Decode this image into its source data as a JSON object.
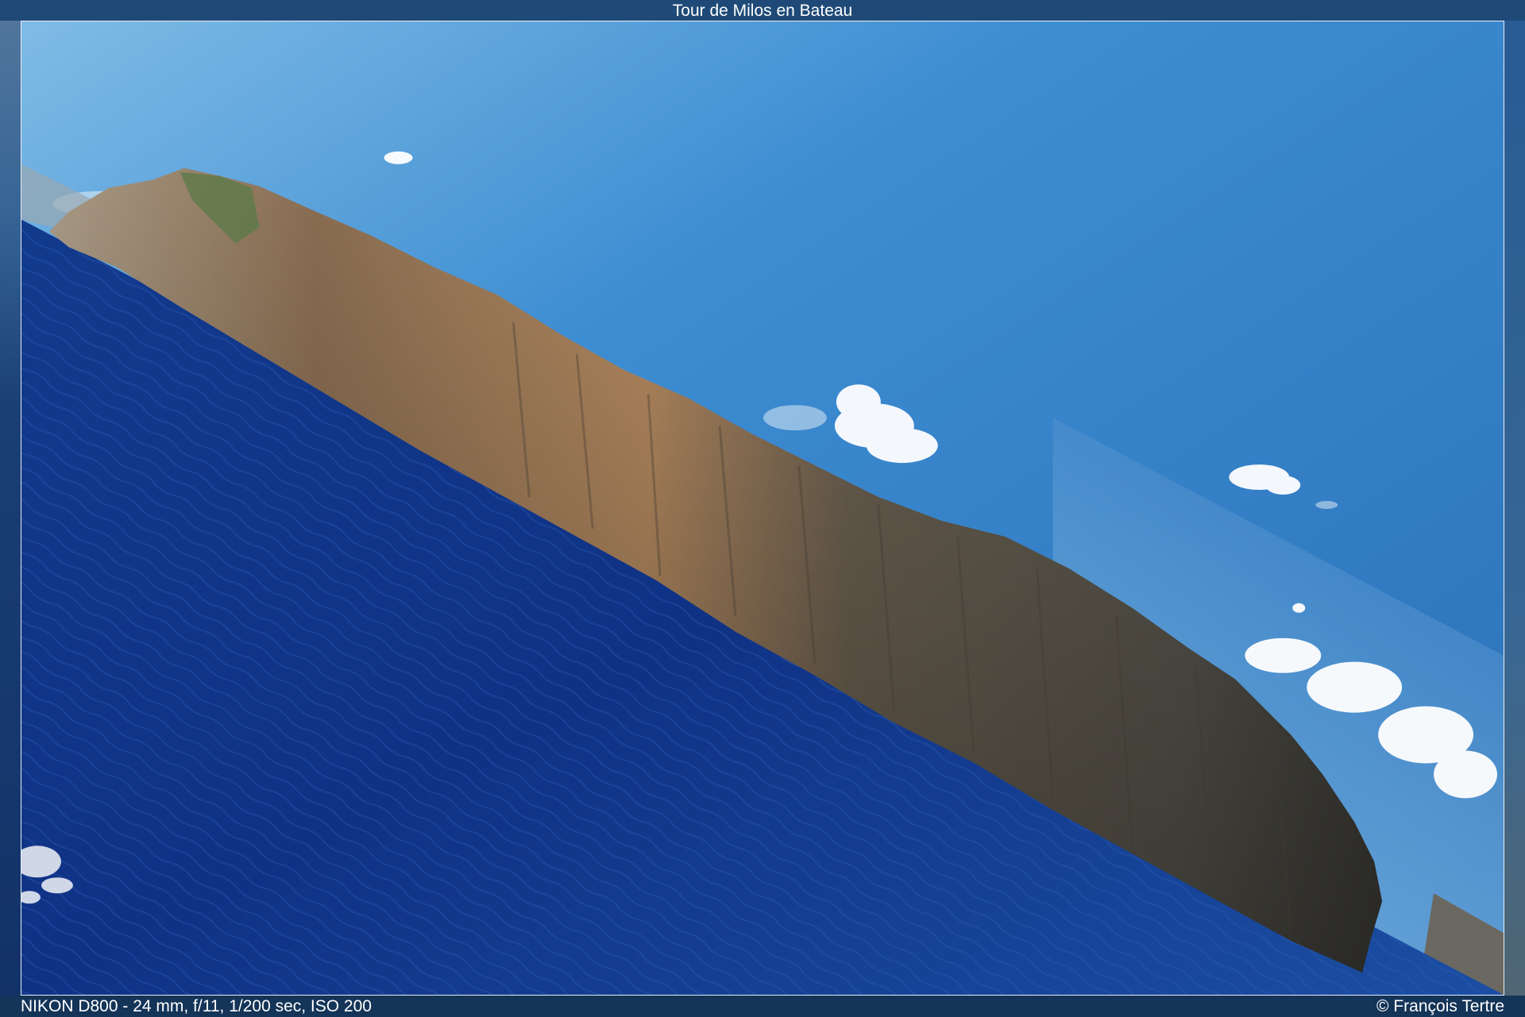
{
  "title": "Tour de Milos en Bateau",
  "exif": "NIKON D800 - 24 mm, f/11, 1/200 sec, ISO 200",
  "copyright": "© François Tertre",
  "colors": {
    "sky_top": "#2f7cc4",
    "sky_light": "#8cc4ea",
    "sea_deep": "#0d2e7a",
    "sea_mid": "#1a4aa0",
    "cliff_light": "#c9a47a",
    "cliff_dark": "#4a4840",
    "background": "#1d3d63"
  }
}
